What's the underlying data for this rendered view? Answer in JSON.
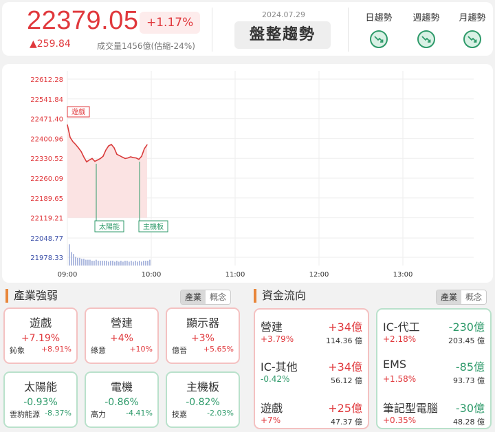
{
  "header": {
    "price": "22379.05",
    "change_pct": "+1.17%",
    "change": "▲259.84",
    "volume": "成交量1456億(估縮-24%)",
    "date": "2024.07.29",
    "trend_label": "盤整趨勢",
    "trends": [
      {
        "label": "日趨勢",
        "icon": "trend-down-icon"
      },
      {
        "label": "週趨勢",
        "icon": "trend-down-icon"
      },
      {
        "label": "月趨勢",
        "icon": "trend-down-icon"
      }
    ]
  },
  "chart": {
    "annotations": {
      "top": "遊戲",
      "mid1": "太陽能",
      "mid2": "主機板"
    },
    "volume_labels": [
      "22048.77",
      "21978.33"
    ]
  },
  "chart_data": {
    "type": "area",
    "y_ticks": [
      "22612.28",
      "22541.84",
      "22471.40",
      "22400.96",
      "22330.52",
      "22260.09",
      "22189.65",
      "22119.21"
    ],
    "x_ticks": [
      "09:00",
      "10:00",
      "11:00",
      "12:00",
      "13:00"
    ],
    "ylim": [
      22119.21,
      22612.28
    ],
    "grid": true,
    "series": [
      {
        "x": [
          "09:00",
          "09:02",
          "09:04",
          "09:06",
          "09:08",
          "09:10",
          "09:12",
          "09:14",
          "09:16",
          "09:18",
          "09:20",
          "09:22",
          "09:24",
          "09:26",
          "09:28",
          "09:30",
          "09:32",
          "09:34",
          "09:36",
          "09:38",
          "09:40",
          "09:42",
          "09:44",
          "09:46",
          "09:48",
          "09:50",
          "09:52",
          "09:54",
          "09:56",
          "09:58"
        ],
        "values": [
          22450,
          22405,
          22390,
          22380,
          22368,
          22355,
          22335,
          22318,
          22325,
          22330,
          22320,
          22325,
          22330,
          22338,
          22360,
          22375,
          22380,
          22368,
          22345,
          22340,
          22335,
          22330,
          22332,
          22336,
          22333,
          22332,
          22327,
          22338,
          22365,
          22379
        ]
      }
    ],
    "volume_bars": [
      22,
      14,
      12,
      9,
      8,
      8,
      7,
      7,
      6,
      6,
      6,
      5,
      5,
      6,
      5,
      5,
      5,
      5,
      5,
      4,
      5,
      5,
      4,
      5,
      4,
      5,
      4,
      5,
      5,
      4,
      5,
      4,
      5,
      4,
      5,
      4,
      5,
      5,
      5,
      6
    ]
  },
  "industry": {
    "title": "產業強弱",
    "toggle": [
      "產業",
      "概念"
    ],
    "cards": [
      {
        "name": "遊戲",
        "pct": "+7.19%",
        "stock": "鈊象",
        "stock_pct": "+8.91%",
        "dir": "up"
      },
      {
        "name": "營建",
        "pct": "+4%",
        "stock": "綠意",
        "stock_pct": "+10%",
        "dir": "up"
      },
      {
        "name": "顯示器",
        "pct": "+3%",
        "stock": "億晉",
        "stock_pct": "+5.65%",
        "dir": "up"
      },
      {
        "name": "太陽能",
        "pct": "-0.93%",
        "stock": "雲豹能源",
        "stock_pct": "-8.37%",
        "dir": "dn"
      },
      {
        "name": "電機",
        "pct": "-0.86%",
        "stock": "高力",
        "stock_pct": "-4.41%",
        "dir": "dn"
      },
      {
        "name": "主機板",
        "pct": "-0.82%",
        "stock": "技嘉",
        "stock_pct": "-2.03%",
        "dir": "dn"
      }
    ]
  },
  "funds": {
    "title": "資金流向",
    "toggle": [
      "產業",
      "概念"
    ],
    "inflow": [
      {
        "name": "營建",
        "value": "+34億",
        "pct": "+3.79%",
        "amount": "114.36 億"
      },
      {
        "name": "IC-其他",
        "value": "+34億",
        "pct": "-0.42%",
        "amount": "56.12 億"
      },
      {
        "name": "遊戲",
        "value": "+25億",
        "pct": "+7%",
        "amount": "47.37 億"
      }
    ],
    "outflow": [
      {
        "name": "IC-代工",
        "value": "-230億",
        "pct": "+2.18%",
        "amount": "203.45 億"
      },
      {
        "name": "EMS",
        "value": "-85億",
        "pct": "+1.58%",
        "amount": "93.73 億"
      },
      {
        "name": "筆記型電腦",
        "value": "-30億",
        "pct": "+0.35%",
        "amount": "48.28 億"
      }
    ]
  },
  "colors": {
    "up": "#e0383c",
    "down": "#2e9a6a",
    "accent": "#e8863a"
  }
}
